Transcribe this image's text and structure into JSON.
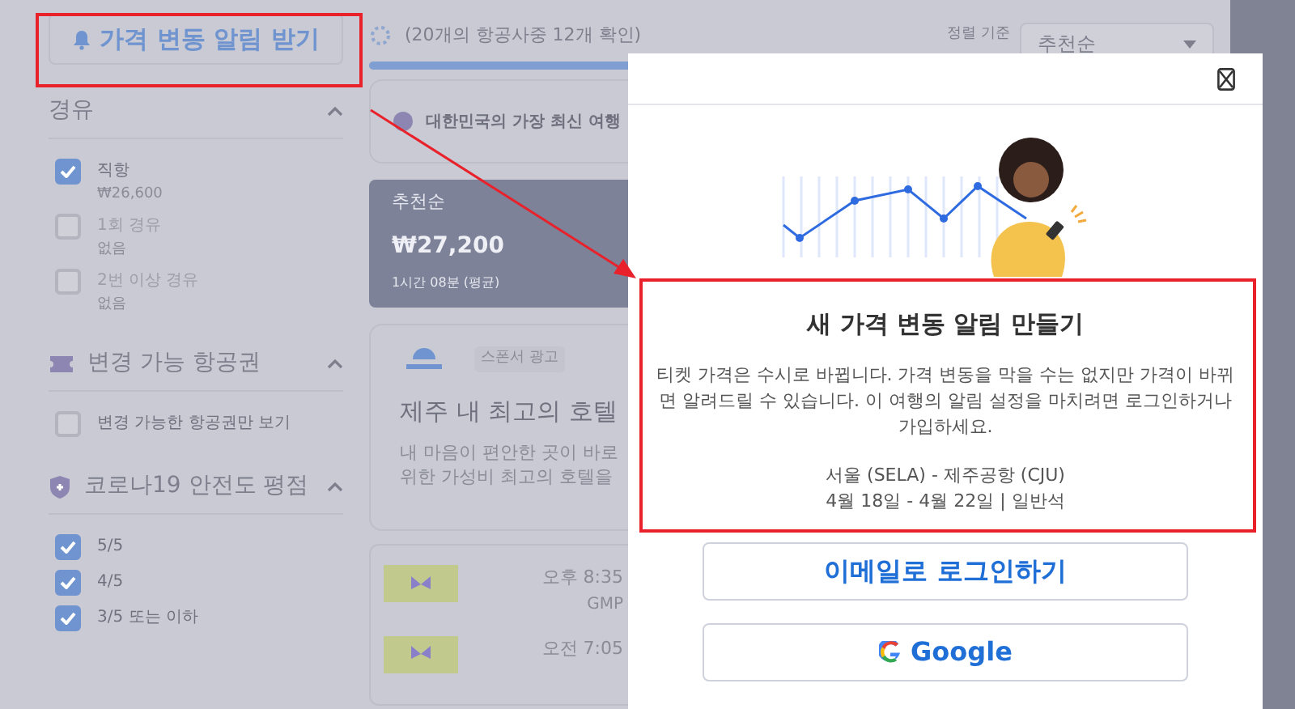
{
  "alert_button": {
    "label": "가격 변동 알림 받기"
  },
  "sidebar": {
    "sections": [
      {
        "kind": "stops",
        "title": "경유",
        "expanded": true,
        "options": [
          {
            "label": "직항",
            "sub": "₩26,600",
            "checked": true,
            "disabled": false
          },
          {
            "label": "1회 경유",
            "sub": "없음",
            "checked": false,
            "disabled": true
          },
          {
            "label": "2번 이상 경유",
            "sub": "없음",
            "checked": false,
            "disabled": true
          }
        ]
      },
      {
        "kind": "ticket",
        "title": "변경 가능 항공권",
        "expanded": true,
        "options": [
          {
            "label": "변경 가능한 항공권만 보기",
            "checked": false,
            "disabled": false
          }
        ]
      },
      {
        "kind": "shield",
        "title": "코로나19 안전도 평점",
        "expanded": true,
        "options": [
          {
            "label": "5/5",
            "checked": true,
            "disabled": false
          },
          {
            "label": "4/5",
            "checked": true,
            "disabled": false
          },
          {
            "label": "3/5 또는 이하",
            "checked": true,
            "disabled": false
          }
        ]
      }
    ]
  },
  "progress": {
    "text": "(20개의 항공사중 12개 확인)",
    "level": 1
  },
  "sort": {
    "label": "정렬 기준",
    "value": "추천순"
  },
  "notice": {
    "text": "대한민국의 가장 최신 여행"
  },
  "sort_tab": {
    "label": "추천순",
    "price": "₩27,200",
    "duration": "1시간 08분 (평균)",
    "selected": true
  },
  "ad": {
    "badge": "스폰서 광고",
    "title": "제주 내 최고의 호텔",
    "lines": [
      "내 마음이 편안한 곳이 바로",
      "위한 가성비 최고의 호텔을"
    ]
  },
  "flights": [
    {
      "time": "오후 8:35",
      "airport": "GMP"
    },
    {
      "time": "오전 7:05"
    }
  ],
  "modal": {
    "title": "새 가격 변동 알림 만들기",
    "body": "티켓 가격은 수시로 바뀝니다. 가격 변동을 막을 수는 없지만 가격이 바뀌면 알려드릴 수 있습니다. 이 여행의 알림 설정을 마치려면 로그인하거나 가입하세요.",
    "route": "서울 (SELA) - 제주공항 (CJU)",
    "dates": "4월 18일 - 4월 22일 | 일반석",
    "buttons": [
      {
        "kind": "email",
        "label": "이메일로 로그인하기"
      },
      {
        "kind": "google",
        "label": "Google"
      }
    ]
  }
}
